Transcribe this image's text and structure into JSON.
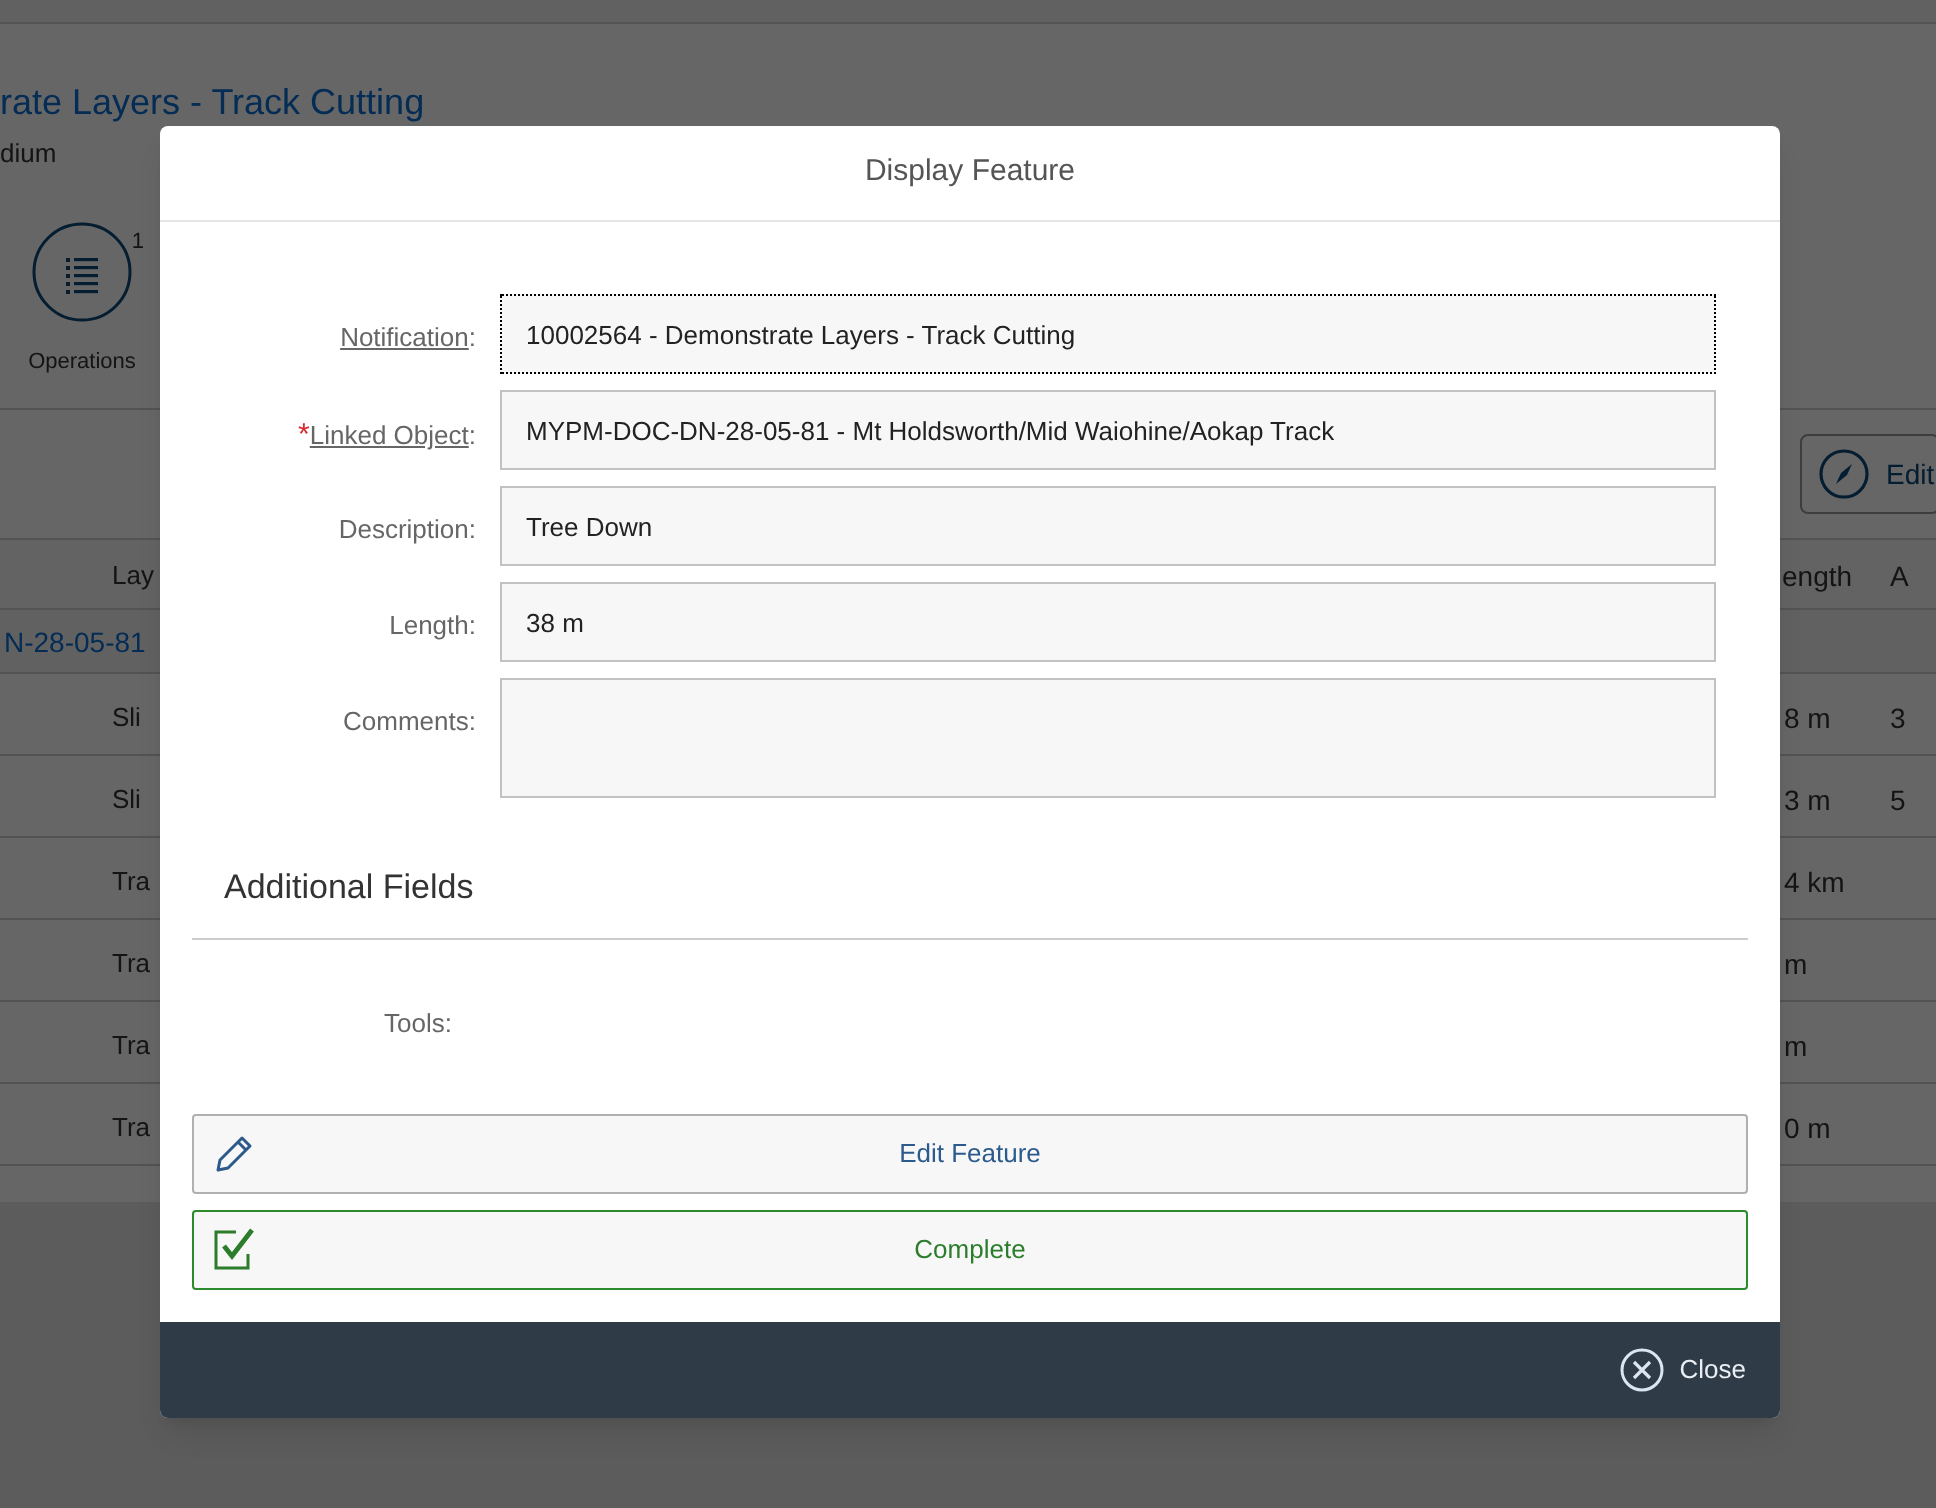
{
  "page": {
    "title": "rate Layers - Track Cutting",
    "subtitle": "dium",
    "header_actions": [
      {
        "label": "Operations",
        "count": "1"
      }
    ],
    "toolbar": {
      "edit_button": "Edit"
    },
    "table": {
      "columns": [
        "Lay",
        "ength",
        "A"
      ],
      "group_row": "N-28-05-81",
      "rows": [
        [
          "Sli",
          "8 m",
          "3"
        ],
        [
          "Sli",
          "3 m",
          "5"
        ],
        [
          "Tra",
          "4 km",
          ""
        ],
        [
          "Tra",
          "m",
          ""
        ],
        [
          "Tra",
          "m",
          ""
        ],
        [
          "Tra",
          "0 m",
          ""
        ]
      ]
    }
  },
  "dialog": {
    "title": "Display Feature",
    "required_marker": "*",
    "fields": [
      {
        "label": "Notification",
        "colon": ":",
        "value": "10002564 - Demonstrate Layers - Track Cutting",
        "link": true,
        "required": false,
        "focused": true,
        "kind": "input"
      },
      {
        "label": "Linked Object",
        "colon": ":",
        "value": "MYPM-DOC-DN-28-05-81 - Mt Holdsworth/Mid Waiohine/Aokap Track",
        "link": true,
        "required": true,
        "focused": false,
        "kind": "input"
      },
      {
        "label": "Description",
        "colon": ":",
        "value": "Tree Down",
        "link": false,
        "required": false,
        "focused": false,
        "kind": "input"
      },
      {
        "label": "Length",
        "colon": ":",
        "value": "38 m",
        "link": false,
        "required": false,
        "focused": false,
        "kind": "input"
      },
      {
        "label": "Comments",
        "colon": ":",
        "link": false,
        "required": false,
        "focused": false,
        "kind": "textarea"
      }
    ],
    "section_title": "Additional Fields",
    "additional_fields": [
      {
        "label": "Tools:"
      }
    ],
    "actions": [
      {
        "kind": "edit",
        "label": "Edit Feature"
      },
      {
        "kind": "complete",
        "label": "Complete"
      }
    ],
    "footer_button": "Close"
  }
}
